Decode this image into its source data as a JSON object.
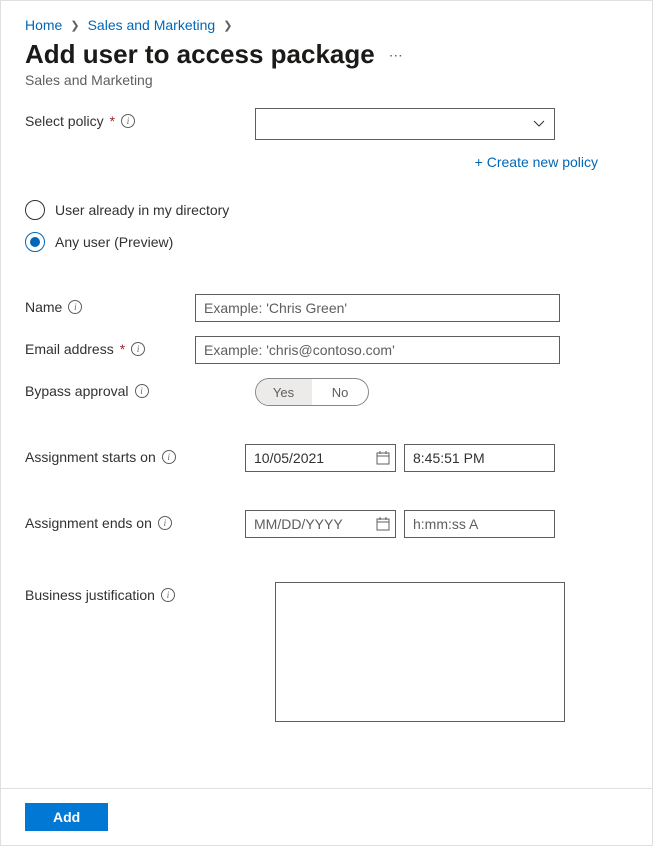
{
  "breadcrumb": {
    "home": "Home",
    "sales": "Sales and Marketing"
  },
  "page": {
    "title": "Add user to access package",
    "subtitle": "Sales and Marketing"
  },
  "policy": {
    "label": "Select policy",
    "create_link": "+ Create new policy"
  },
  "radios": {
    "directory": "User already in my directory",
    "any_user": "Any user (Preview)"
  },
  "fields": {
    "name_label": "Name",
    "name_placeholder": "Example: 'Chris Green'",
    "email_label": "Email address",
    "email_placeholder": "Example: 'chris@contoso.com'",
    "bypass_label": "Bypass approval",
    "bypass_yes": "Yes",
    "bypass_no": "No",
    "starts_label": "Assignment starts on",
    "starts_date": "10/05/2021",
    "starts_time": "8:45:51 PM",
    "ends_label": "Assignment ends on",
    "ends_date_placeholder": "MM/DD/YYYY",
    "ends_time_placeholder": "h:mm:ss A",
    "justification_label": "Business justification"
  },
  "actions": {
    "add": "Add"
  }
}
